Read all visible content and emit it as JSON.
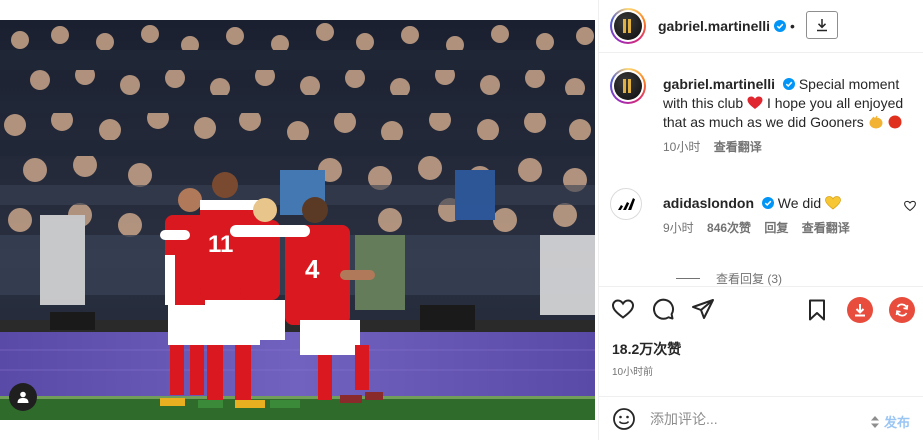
{
  "post": {
    "username": "gabriel.martinelli",
    "separator": "•",
    "caption_text": "Special moment with this club",
    "caption_text2": "I hope you all enjoyed that as much as we did Gooners",
    "caption_time": "10小时",
    "caption_translate": "查看翻译"
  },
  "comments": [
    {
      "username": "adidaslondon",
      "text": "We did",
      "time": "9小时",
      "likes": "846次赞",
      "reply": "回复",
      "translate": "查看翻译",
      "view_replies": "查看回复 (3)"
    }
  ],
  "stats": {
    "likes": "18.2万次赞",
    "time": "10小时前"
  },
  "composer": {
    "placeholder": "添加评论...",
    "post_label": "发布"
  },
  "colors": {
    "verified": "#0095f6",
    "arsenal_red": "#d9191f",
    "action_red": "#e84c3d",
    "post_disabled": "#9bc6f3"
  },
  "icons": [
    "tag-icon",
    "verified-icon",
    "download-icon",
    "heart-icon",
    "comment-icon",
    "share-icon",
    "bookmark-icon",
    "emoji-icon",
    "adidas-logo-icon"
  ]
}
